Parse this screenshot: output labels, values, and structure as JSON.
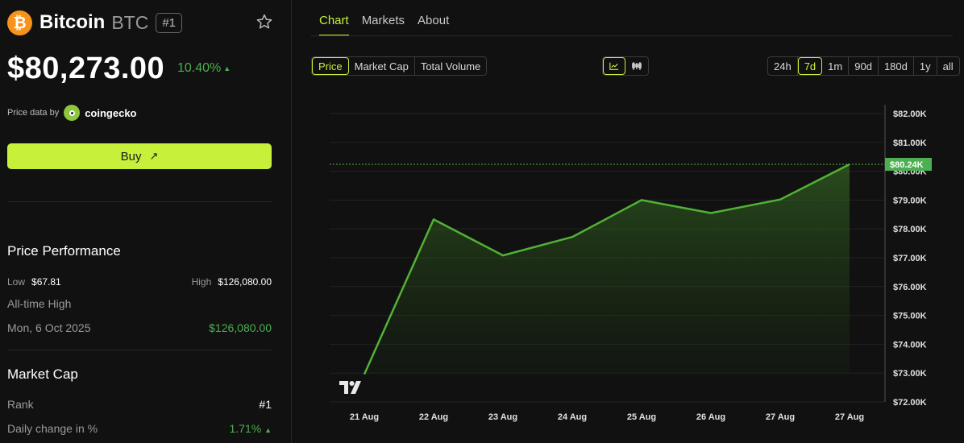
{
  "coin": {
    "name": "Bitcoin",
    "ticker": "BTC",
    "rank": "#1",
    "logo_symbol": "₿",
    "price": "$80,273.00",
    "change": "10.40%",
    "change_arrow": "▲"
  },
  "price_data": {
    "label": "Price data by",
    "provider": "coingecko"
  },
  "buy": {
    "label": "Buy",
    "arrow": "↗"
  },
  "performance": {
    "title": "Price Performance",
    "low_label": "Low",
    "low_value": "$67.81",
    "high_label": "High",
    "high_value": "$126,080.00",
    "ath_label": "All-time High",
    "ath_date": "Mon, 6 Oct 2025",
    "ath_value": "$126,080.00"
  },
  "market_cap": {
    "title": "Market Cap",
    "rank_label": "Rank",
    "rank_value": "#1",
    "daily_label": "Daily change in %",
    "daily_value": "1.71%",
    "daily_arrow": "▲"
  },
  "tabs": [
    "Chart",
    "Markets",
    "About"
  ],
  "metric_options": [
    "Price",
    "Market Cap",
    "Total Volume"
  ],
  "range_options": [
    "24h",
    "7d",
    "1m",
    "90d",
    "180d",
    "1y",
    "all"
  ],
  "colors": {
    "accent": "#c6f03a",
    "up": "#4caf50",
    "line": "#52b135",
    "bitcoin": "#f7931a"
  },
  "chart_data": {
    "type": "area",
    "x": [
      "21 Aug",
      "22 Aug",
      "23 Aug",
      "24 Aug",
      "25 Aug",
      "26 Aug",
      "27 Aug",
      "27 Aug"
    ],
    "values": [
      72960,
      78330,
      77080,
      77720,
      79000,
      78550,
      79020,
      80240
    ],
    "ylim": [
      72000,
      82000
    ],
    "yticks": [
      "$82.00K",
      "$81.00K",
      "$80.00K",
      "$79.00K",
      "$78.00K",
      "$77.00K",
      "$76.00K",
      "$75.00K",
      "$74.00K",
      "$73.00K",
      "$72.00K"
    ],
    "current_label": "$80.24K",
    "grid": true
  }
}
